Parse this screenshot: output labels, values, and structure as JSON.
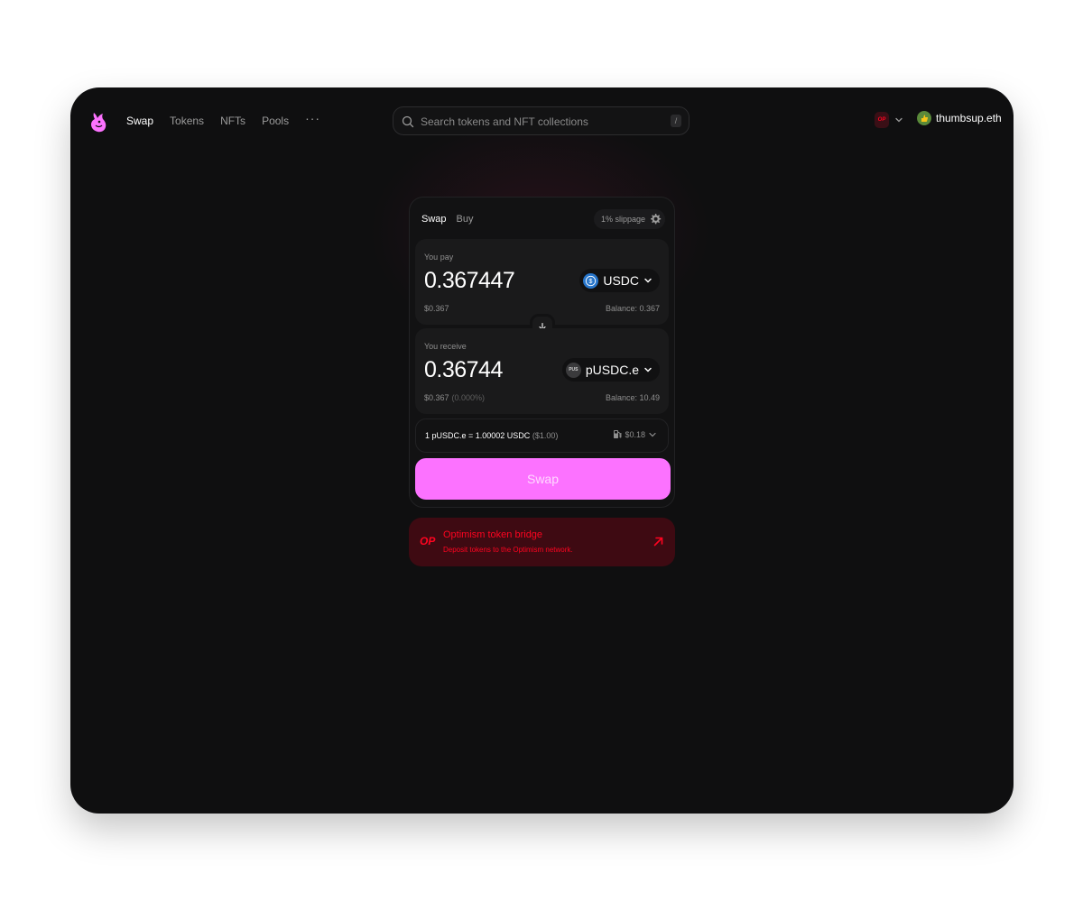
{
  "nav": {
    "links": [
      "Swap",
      "Tokens",
      "NFTs",
      "Pools"
    ],
    "more": "···"
  },
  "search": {
    "placeholder": "Search tokens and NFT collections",
    "shortcut": "/"
  },
  "network": {
    "badge": "OP"
  },
  "account": {
    "name": "thumbsup.eth"
  },
  "swap_card": {
    "tabs": [
      "Swap",
      "Buy"
    ],
    "slippage": "1% slippage",
    "pay": {
      "label": "You pay",
      "amount": "0.367447",
      "usd": "$0.367",
      "token": "USDC",
      "balance": "Balance: 0.367"
    },
    "receive": {
      "label": "You receive",
      "amount": "0.36744",
      "usd": "$0.367",
      "price_impact": "(0.000%)",
      "token": "pUSDC.e",
      "token_icon_text": "PUS",
      "balance": "Balance: 10.49"
    },
    "rate": {
      "text": "1 pUSDC.e = 1.00002 USDC",
      "usd": "($1.00)"
    },
    "gas": "$0.18",
    "swap_button": "Swap"
  },
  "bridge": {
    "badge": "OP",
    "title": "Optimism token bridge",
    "subtitle": "Deposit tokens to the Optimism network."
  },
  "colors": {
    "accent": "#fc72ff",
    "background": "#0f0f10",
    "bridge_red": "#ff0420",
    "usdc_blue": "#2775ca"
  }
}
